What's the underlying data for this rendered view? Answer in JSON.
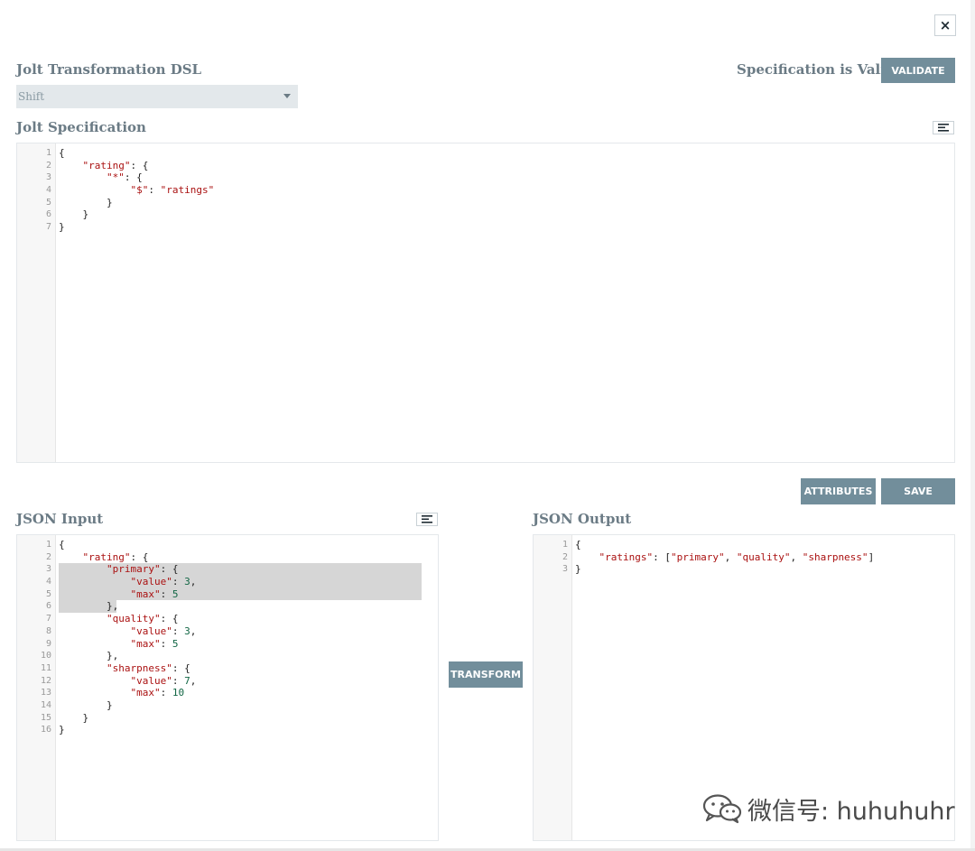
{
  "dialog": {
    "close_glyph": "×"
  },
  "header": {
    "dsl_title": "Jolt Transformation DSL",
    "dsl_selected": "Shift",
    "valid_text": "Specification is Valid",
    "validate_label": "VALIDATE"
  },
  "spec": {
    "title": "Jolt Specification",
    "line_numbers": [
      "1",
      "2",
      "3",
      "4",
      "5",
      "6",
      "7"
    ]
  },
  "actions": {
    "attributes_label": "ATTRIBUTES",
    "save_label": "SAVE",
    "transform_label": "TRANSFORM"
  },
  "input": {
    "title": "JSON Input",
    "line_numbers": [
      "1",
      "2",
      "3",
      "4",
      "5",
      "6",
      "7",
      "8",
      "9",
      "10",
      "11",
      "12",
      "13",
      "14",
      "15",
      "16"
    ]
  },
  "output": {
    "title": "JSON Output",
    "line_numbers": [
      "1",
      "2",
      "3"
    ]
  },
  "watermark": {
    "text": "微信号: huhuhuhr"
  },
  "colors": {
    "button_bg": "#728e9b",
    "title": "#6b7b85",
    "string": "#aa1111",
    "number": "#116644",
    "selection": "#d6d6d6"
  }
}
